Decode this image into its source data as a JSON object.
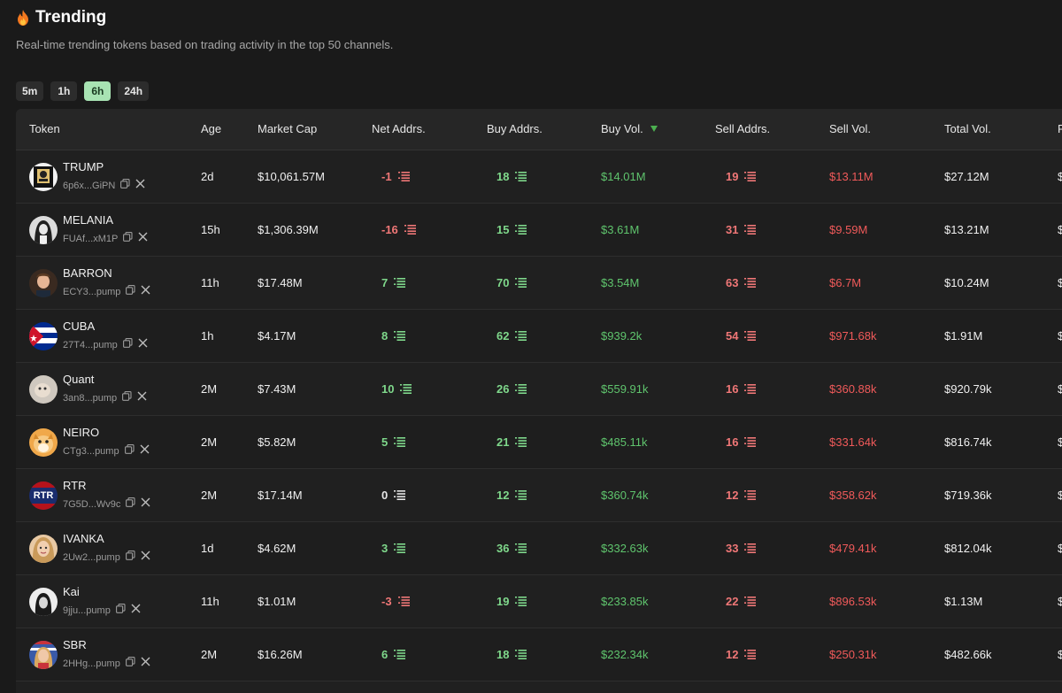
{
  "header": {
    "title": "Trending",
    "subtitle": "Real-time trending tokens based on trading activity in the top 50 channels."
  },
  "timeframes": [
    {
      "label": "5m",
      "active": false
    },
    {
      "label": "1h",
      "active": false
    },
    {
      "label": "6h",
      "active": true
    },
    {
      "label": "24h",
      "active": false
    }
  ],
  "columns": {
    "token": "Token",
    "age": "Age",
    "market_cap": "Market Cap",
    "net_addrs": "Net Addrs.",
    "buy_addrs": "Buy Addrs.",
    "buy_vol": "Buy Vol.",
    "sell_addrs": "Sell Addrs.",
    "sell_vol": "Sell Vol.",
    "total_vol": "Total Vol.",
    "cut_off": "F"
  },
  "colors": {
    "positive": "#7fd88b",
    "negative": "#f07777",
    "buy_vol": "#5fc46d",
    "sell_vol": "#f05a5a",
    "active_tab": "#a8e3b3"
  },
  "rows": [
    {
      "name": "TRUMP",
      "addr": "6p6x...GiPN",
      "age": "2d",
      "mcap": "$10,061.57M",
      "net": "-1",
      "buy": "18",
      "buyvol": "$14.01M",
      "sell": "19",
      "sellvol": "$13.11M",
      "total": "$27.12M",
      "avatar": "trump"
    },
    {
      "name": "MELANIA",
      "addr": "FUAf...xM1P",
      "age": "15h",
      "mcap": "$1,306.39M",
      "net": "-16",
      "buy": "15",
      "buyvol": "$3.61M",
      "sell": "31",
      "sellvol": "$9.59M",
      "total": "$13.21M",
      "avatar": "melania"
    },
    {
      "name": "BARRON",
      "addr": "ECY3...pump",
      "age": "11h",
      "mcap": "$17.48M",
      "net": "7",
      "buy": "70",
      "buyvol": "$3.54M",
      "sell": "63",
      "sellvol": "$6.7M",
      "total": "$10.24M",
      "avatar": "barron"
    },
    {
      "name": "CUBA",
      "addr": "27T4...pump",
      "age": "1h",
      "mcap": "$4.17M",
      "net": "8",
      "buy": "62",
      "buyvol": "$939.2k",
      "sell": "54",
      "sellvol": "$971.68k",
      "total": "$1.91M",
      "avatar": "cuba"
    },
    {
      "name": "Quant",
      "addr": "3an8...pump",
      "age": "2M",
      "mcap": "$7.43M",
      "net": "10",
      "buy": "26",
      "buyvol": "$559.91k",
      "sell": "16",
      "sellvol": "$360.88k",
      "total": "$920.79k",
      "avatar": "quant"
    },
    {
      "name": "NEIRO",
      "addr": "CTg3...pump",
      "age": "2M",
      "mcap": "$5.82M",
      "net": "5",
      "buy": "21",
      "buyvol": "$485.11k",
      "sell": "16",
      "sellvol": "$331.64k",
      "total": "$816.74k",
      "avatar": "neiro"
    },
    {
      "name": "RTR",
      "addr": "7G5D...Wv9c",
      "age": "2M",
      "mcap": "$17.14M",
      "net": "0",
      "buy": "12",
      "buyvol": "$360.74k",
      "sell": "12",
      "sellvol": "$358.62k",
      "total": "$719.36k",
      "avatar": "rtr",
      "avatar_text": "RTR"
    },
    {
      "name": "IVANKA",
      "addr": "2Uw2...pump",
      "age": "1d",
      "mcap": "$4.62M",
      "net": "3",
      "buy": "36",
      "buyvol": "$332.63k",
      "sell": "33",
      "sellvol": "$479.41k",
      "total": "$812.04k",
      "avatar": "ivanka"
    },
    {
      "name": "Kai",
      "addr": "9jju...pump",
      "age": "11h",
      "mcap": "$1.01M",
      "net": "-3",
      "buy": "19",
      "buyvol": "$233.85k",
      "sell": "22",
      "sellvol": "$896.53k",
      "total": "$1.13M",
      "avatar": "kai"
    },
    {
      "name": "SBR",
      "addr": "2HHg...pump",
      "age": "2M",
      "mcap": "$16.26M",
      "net": "6",
      "buy": "18",
      "buyvol": "$232.34k",
      "sell": "12",
      "sellvol": "$250.31k",
      "total": "$482.66k",
      "avatar": "sbr"
    }
  ]
}
